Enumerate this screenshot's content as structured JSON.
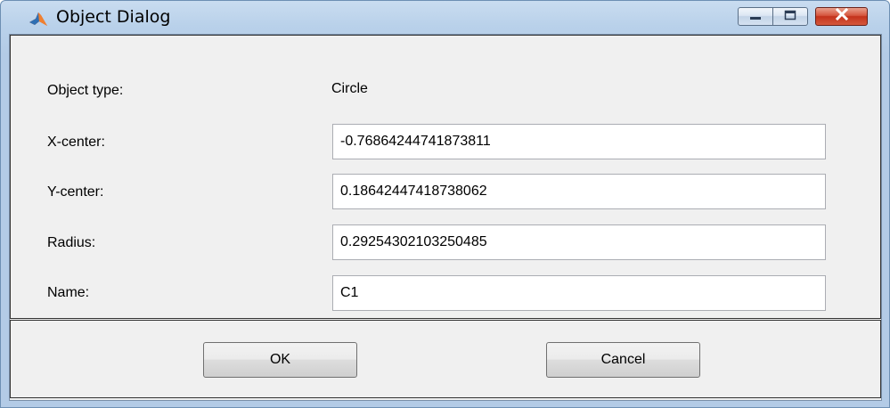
{
  "window": {
    "title": "Object Dialog",
    "icon": "matlab-icon",
    "controls": [
      "minimize-icon",
      "maximize-icon",
      "close-icon"
    ]
  },
  "form": {
    "object_type_label": "Object type:",
    "object_type_value": "Circle",
    "x_center_label": "X-center:",
    "x_center_value": "-0.76864244741873811",
    "y_center_label": "Y-center:",
    "y_center_value": "0.18642447418738062",
    "radius_label": "Radius:",
    "radius_value": "0.29254302103250485",
    "name_label": "Name:",
    "name_value": "C1"
  },
  "buttons": {
    "ok": "OK",
    "cancel": "Cancel"
  },
  "colors": {
    "titlebar": "#b9d1ea",
    "close_button": "#c4321b",
    "dialog_background": "#f0f0f0"
  }
}
